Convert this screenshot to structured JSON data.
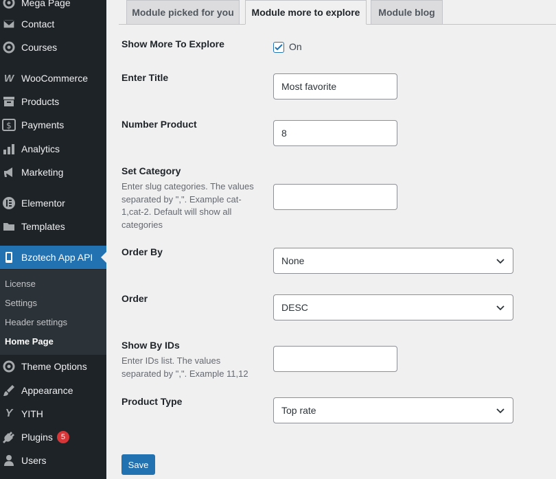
{
  "sidebar": {
    "items": [
      {
        "label": "Mega Page",
        "icon": "mega-page-icon"
      },
      {
        "label": "Contact",
        "icon": "envelope-icon"
      },
      {
        "label": "Courses",
        "icon": "courses-icon"
      },
      {
        "label": "WooCommerce",
        "icon": "woocommerce-icon"
      },
      {
        "label": "Products",
        "icon": "archive-icon"
      },
      {
        "label": "Payments",
        "icon": "dollar-icon"
      },
      {
        "label": "Analytics",
        "icon": "bar-chart-icon"
      },
      {
        "label": "Marketing",
        "icon": "megaphone-icon"
      },
      {
        "label": "Elementor",
        "icon": "elementor-icon"
      },
      {
        "label": "Templates",
        "icon": "folder-icon"
      },
      {
        "label": "Bzotech App API",
        "icon": "mobile-icon"
      },
      {
        "label": "Theme Options",
        "icon": "theme-options-icon"
      },
      {
        "label": "Appearance",
        "icon": "paintbrush-icon"
      },
      {
        "label": "YITH",
        "icon": "yith-icon"
      },
      {
        "label": "Plugins",
        "icon": "plug-icon",
        "badge": "5"
      },
      {
        "label": "Users",
        "icon": "user-icon"
      }
    ],
    "submenu": [
      "License",
      "Settings",
      "Header settings",
      "Home Page"
    ]
  },
  "tabs": [
    "Module picked for you",
    "Module more to explore",
    "Module blog"
  ],
  "form": {
    "show_more_label": "Show More To Explore",
    "show_more_value": "On",
    "title_label": "Enter Title",
    "title_value": "Most favorite",
    "number_label": "Number Product",
    "number_value": "8",
    "category_label": "Set Category",
    "category_desc": "Enter slug categories. The values separated by \",\". Example cat-1,cat-2. Default will show all categories",
    "category_value": "",
    "orderby_label": "Order By",
    "orderby_value": "None",
    "order_label": "Order",
    "order_value": "DESC",
    "ids_label": "Show By IDs",
    "ids_desc": "Enter IDs list. The values separated by \",\". Example 11,12",
    "ids_value": "",
    "type_label": "Product Type",
    "type_value": "Top rate",
    "save_label": "Save"
  },
  "colors": {
    "sidebar_bg": "#1d2327",
    "submenu_bg": "#2c3338",
    "accent": "#2271b1",
    "badge": "#d63638"
  }
}
